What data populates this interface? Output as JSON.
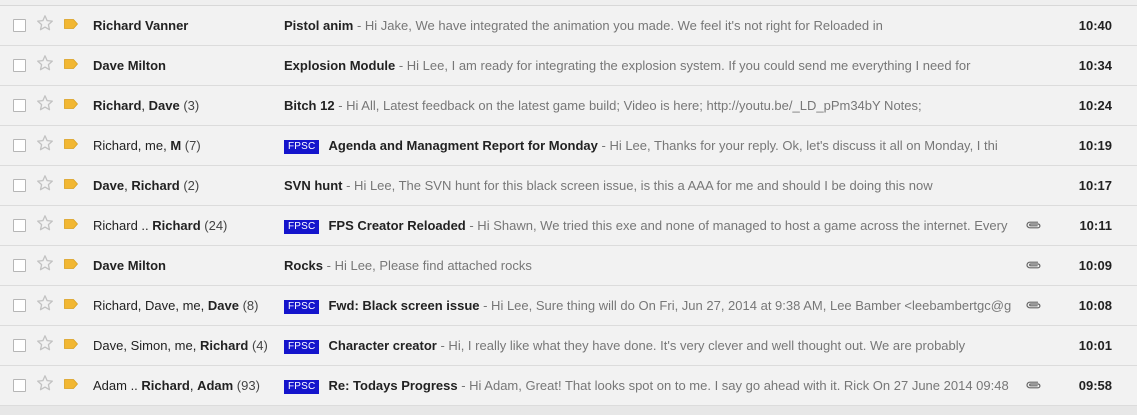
{
  "colors": {
    "background": "#f2f2f2",
    "row_border": "#dcdcdc",
    "label_marker": "#f2b733",
    "tag_background": "#1414cc",
    "tag_text": "#ffffff",
    "snippet_text": "#777777",
    "star_outline": "#c2c2c2"
  },
  "icons": {
    "checkbox": "checkbox-icon",
    "star": "star-outline-icon",
    "label": "important-label-icon",
    "attachment": "paperclip-icon"
  },
  "emails": [
    {
      "sender_parts": [
        {
          "text": "Richard Vanner",
          "bold": true
        }
      ],
      "count": "",
      "tag": "",
      "subject": "Pistol anim",
      "snippet": " - Hi Jake, We have integrated the animation you made. We feel it's not right for Reloaded in",
      "attachment": false,
      "time": "10:40"
    },
    {
      "sender_parts": [
        {
          "text": "Dave Milton",
          "bold": true
        }
      ],
      "count": "",
      "tag": "",
      "subject": "Explosion Module",
      "snippet": " - Hi Lee, I am ready for integrating the explosion system. If you could send me everything I need for",
      "attachment": false,
      "time": "10:34"
    },
    {
      "sender_parts": [
        {
          "text": "Richard",
          "bold": true
        },
        {
          "text": ", ",
          "bold": false
        },
        {
          "text": "Dave",
          "bold": true
        }
      ],
      "count": " (3)",
      "tag": "",
      "subject": "Bitch 12",
      "snippet": " - Hi All, Latest feedback on the latest game build; Video is here; http://youtu.be/_LD_pPm34bY Notes;",
      "attachment": false,
      "time": "10:24"
    },
    {
      "sender_parts": [
        {
          "text": "Richard, me, ",
          "bold": false
        },
        {
          "text": "M",
          "bold": true
        }
      ],
      "count": " (7)",
      "tag": "FPSC",
      "subject": "Agenda and Managment Report for Monday",
      "snippet": " - Hi Lee, Thanks for your reply. Ok, let's discuss it all on Monday, I thi",
      "attachment": false,
      "time": "10:19"
    },
    {
      "sender_parts": [
        {
          "text": "Dave",
          "bold": true
        },
        {
          "text": ", ",
          "bold": false
        },
        {
          "text": "Richard",
          "bold": true
        }
      ],
      "count": " (2)",
      "tag": "",
      "subject": "SVN hunt",
      "snippet": " - Hi Lee, The SVN hunt for this black screen issue, is this a AAA for me and should I be doing this now",
      "attachment": false,
      "time": "10:17"
    },
    {
      "sender_parts": [
        {
          "text": "Richard .. ",
          "bold": false
        },
        {
          "text": "Richard",
          "bold": true
        }
      ],
      "count": " (24)",
      "tag": "FPSC",
      "subject": "FPS Creator Reloaded",
      "snippet": " - Hi Shawn, We tried this exe and none of managed to host a game across the internet. Every",
      "attachment": true,
      "time": "10:11"
    },
    {
      "sender_parts": [
        {
          "text": "Dave Milton",
          "bold": true
        }
      ],
      "count": "",
      "tag": "",
      "subject": "Rocks",
      "snippet": " - Hi Lee, Please find attached rocks",
      "attachment": true,
      "time": "10:09"
    },
    {
      "sender_parts": [
        {
          "text": "Richard, Dave, me, ",
          "bold": false
        },
        {
          "text": "Dave",
          "bold": true
        }
      ],
      "count": " (8)",
      "tag": "FPSC",
      "subject": "Fwd: Black screen issue",
      "snippet": " - Hi Lee, Sure thing will do On Fri, Jun 27, 2014 at 9:38 AM, Lee Bamber <leebambertgc@g",
      "attachment": true,
      "time": "10:08"
    },
    {
      "sender_parts": [
        {
          "text": "Dave, Simon, me, ",
          "bold": false
        },
        {
          "text": "Richard",
          "bold": true
        }
      ],
      "count": " (4)",
      "tag": "FPSC",
      "subject": "Character creator",
      "snippet": " - Hi, I really like what they have done. It's very clever and well thought out. We are probably",
      "attachment": false,
      "time": "10:01"
    },
    {
      "sender_parts": [
        {
          "text": "Adam .. ",
          "bold": false
        },
        {
          "text": "Richard",
          "bold": true
        },
        {
          "text": ", ",
          "bold": false
        },
        {
          "text": "Adam",
          "bold": true
        }
      ],
      "count": " (93)",
      "tag": "FPSC",
      "subject": "Re: Todays Progress",
      "snippet": " - Hi Adam, Great! That looks spot on to me. I say go ahead with it. Rick On 27 June 2014 09:48",
      "attachment": true,
      "time": "09:58"
    }
  ]
}
